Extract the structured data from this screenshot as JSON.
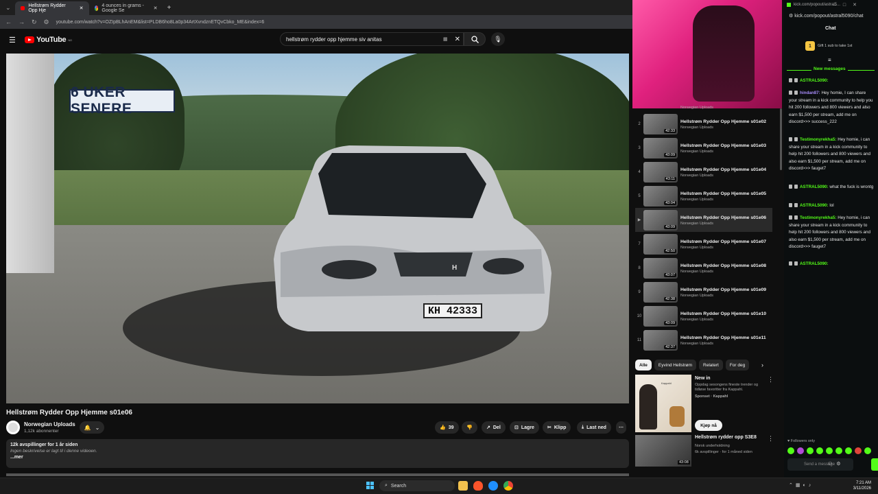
{
  "browser": {
    "tabs": [
      {
        "label": "Hellstrøm Rydder Opp Hje",
        "active": true
      },
      {
        "label": "4 ounces in grams - Google Se",
        "active": false
      }
    ],
    "url": "youtube.com/watch?v=OZIpBLhAnEM&list=PLDB6ho8La0p34ArtXvndznETQvCbko_ME&index=6"
  },
  "youtube": {
    "logo": "YouTube",
    "logo_suffix": "NO",
    "search_value": "hellstrøm rydder opp hjemme siv anitas",
    "video_overlay": "6 UKER SENERE",
    "plate": "KH 42333",
    "video_title": "Hellstrøm Rydder Opp Hjemme s01e06",
    "channel_name": "Norwegian Uploads",
    "channel_subs": "1,12k abonnenter",
    "actions": {
      "like_count": "39",
      "share": "Del",
      "save": "Lagre",
      "clip": "Klipp",
      "download": "Last ned"
    },
    "description": {
      "stats": "12k avspillinger  for 1 år siden",
      "text": "Ingen beskrivelse er lagt til i denne videoen.",
      "more": "...mer"
    }
  },
  "playlist": {
    "partial_channel": "Norwegian Uploads",
    "items": [
      {
        "index": "2",
        "title": "Hellstrøm Rydder Opp Hjemme s01e02",
        "channel": "Norwegian Uploads",
        "duration": "42:33",
        "active": false
      },
      {
        "index": "3",
        "title": "Hellstrøm Rydder Opp Hjemme s01e03",
        "channel": "Norwegian Uploads",
        "duration": "43:09",
        "active": false
      },
      {
        "index": "4",
        "title": "Hellstrøm Rydder Opp Hjemme s01e04",
        "channel": "Norwegian Uploads",
        "duration": "43:11",
        "active": false
      },
      {
        "index": "5",
        "title": "Hellstrøm Rydder Opp Hjemme s01e05",
        "channel": "Norwegian Uploads",
        "duration": "43:04",
        "active": false
      },
      {
        "index": "▶",
        "title": "Hellstrøm Rydder Opp Hjemme s01e06",
        "channel": "Norwegian Uploads",
        "duration": "43:09",
        "active": true
      },
      {
        "index": "7",
        "title": "Hellstrøm Rydder Opp Hjemme s01e07",
        "channel": "Norwegian Uploads",
        "duration": "42:50",
        "active": false
      },
      {
        "index": "8",
        "title": "Hellstrøm Rydder Opp Hjemme s01e08",
        "channel": "Norwegian Uploads",
        "duration": "43:07",
        "active": false
      },
      {
        "index": "9",
        "title": "Hellstrøm Rydder Opp Hjemme s01e09",
        "channel": "Norwegian Uploads",
        "duration": "42:38",
        "active": false
      },
      {
        "index": "10",
        "title": "Hellstrøm Rydder Opp Hjemme s01e10",
        "channel": "Norwegian Uploads",
        "duration": "43:09",
        "active": false
      },
      {
        "index": "11",
        "title": "Hellstrøm Rydder Opp Hjemme s01e11",
        "channel": "Norwegian Uploads",
        "duration": "42:37",
        "active": false
      }
    ]
  },
  "chips": [
    "Alle",
    "Eyvind Hellstrøm",
    "Relatert",
    "For deg"
  ],
  "ad": {
    "brand_in_img": "Kappahl",
    "title": "New in",
    "desc": "Oppdag sesongens fineste trender og tidløse favoritter fra Kappahl.",
    "sponsored": "Sponset · Kappahl",
    "cta": "Kjøp nå"
  },
  "recommended": {
    "title": "Hellstrøm rydder opp S3E8",
    "channel": "Norsk underholdning",
    "meta": "6k avspillinger · for 1 måned siden",
    "duration": "43:08"
  },
  "kick": {
    "tab_url": "kick.com/popout/astral5...",
    "url": "kick.com/popout/astral5090/chat",
    "title": "Chat",
    "gift_count": "1",
    "gift_text": "Gift 1 sub to take 1st",
    "new_messages": "New messages",
    "messages": [
      {
        "user": "ASTRAL5090:",
        "text": "",
        "color": "green"
      },
      {
        "user": "hindan87:",
        "text": "Hey homie, I can share your stream in a kick community to help you hit 200 followers and 800 viewers and also earn $1,500 per stream, add me on discord>>> success_222",
        "color": "purple"
      },
      {
        "user": "Testimonyrekha5:",
        "text": "Hey homie, i can share your stream in a kick community to help hit 200 followers and 800 viewers and also earn $1,500 per stream, add me on discord>>> fauget7",
        "color": "green"
      },
      {
        "user": "ASTRAL5090:",
        "text": "what the fuck is wrontg",
        "color": "green"
      },
      {
        "user": "ASTRAL5090:",
        "text": "lol",
        "color": "green"
      },
      {
        "user": "Testimonyrekha5:",
        "text": "Hey homie, i can share your stream in a kick community to help hit 200 followers and 800 viewers and also earn $1,500 per stream, add me on discord>>> fauget7",
        "color": "green"
      },
      {
        "user": "ASTRAL5090:",
        "text": "",
        "color": "green"
      }
    ],
    "followers_only": "Followers only",
    "send_placeholder": "Send a message"
  },
  "taskbar": {
    "search": "Search",
    "time": "7:21 AM",
    "date": "3/11/2026"
  },
  "colors": {
    "yt_red": "#ff0000",
    "kick_green": "#53fc18"
  }
}
